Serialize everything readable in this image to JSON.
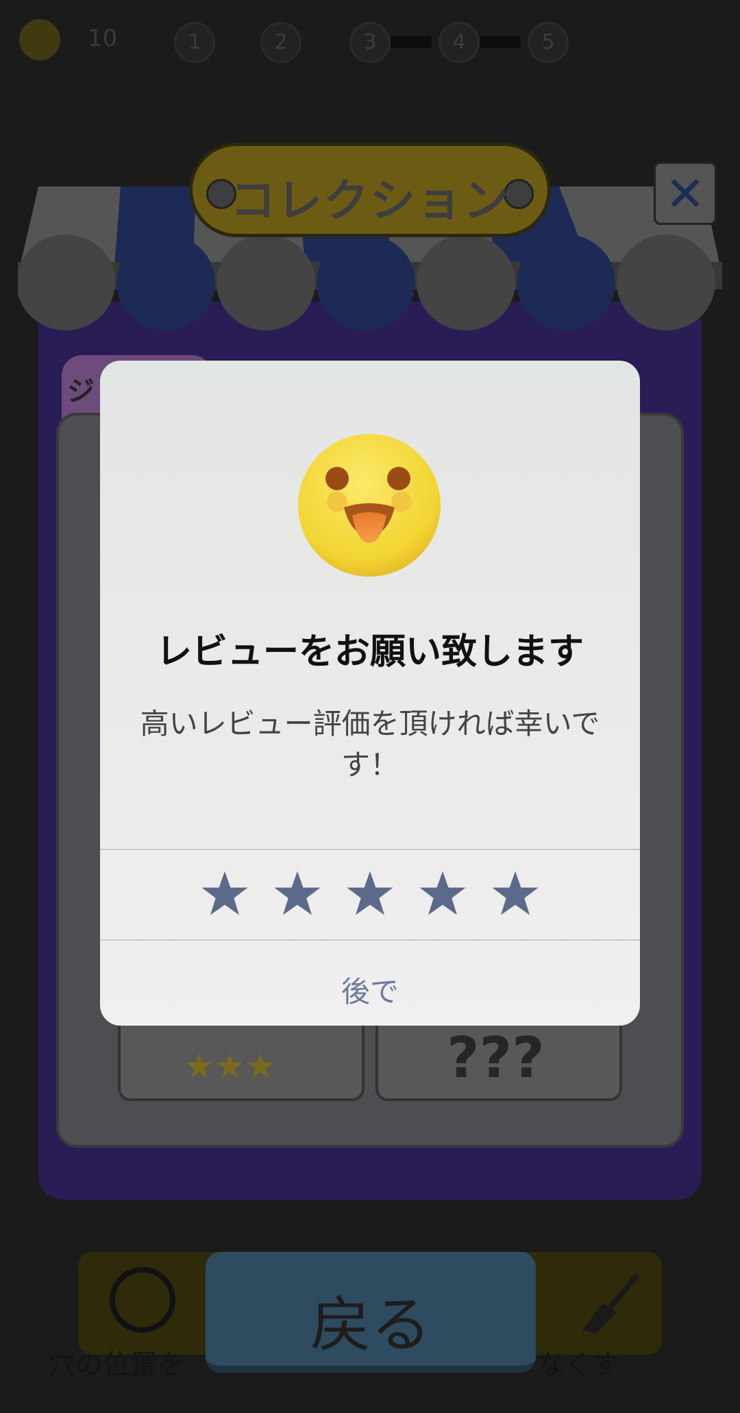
{
  "hud": {
    "coin_count": "10",
    "levels": [
      "1",
      "2",
      "3",
      "4",
      "5"
    ]
  },
  "header": {
    "title": "コレクション",
    "close_label": "✕"
  },
  "board": {
    "tab_label": "ジ",
    "locked_label": "???"
  },
  "dialog": {
    "title": "レビューをお願い致します",
    "message": "高いレビュー評価を頂ければ幸いです！",
    "rating_max": 5,
    "later_label": "後で"
  },
  "footer": {
    "back_label": "戻る",
    "hint_text": "穴の位置を",
    "hint_text_right": "なくす"
  },
  "colors": {
    "star": "#5b6a8a",
    "link": "#6a7a9c",
    "emoji_face": "#f5d83a"
  }
}
